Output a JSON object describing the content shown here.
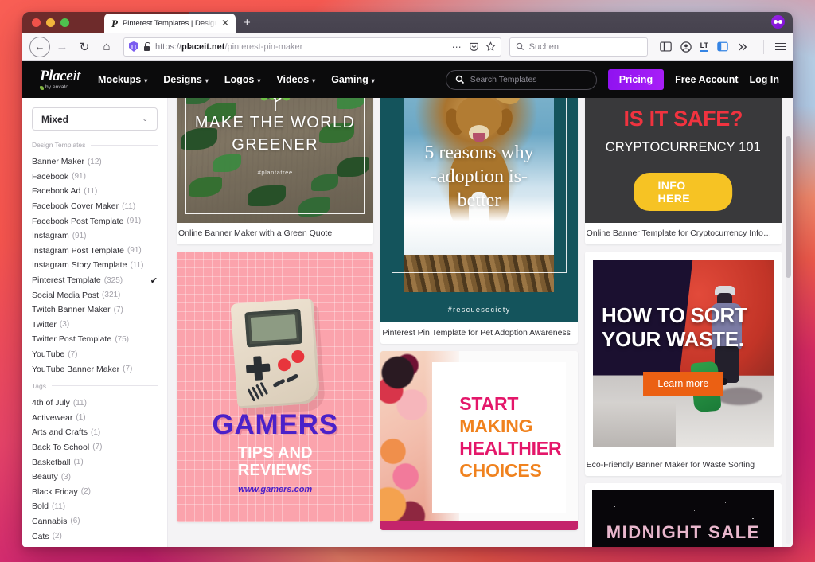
{
  "window": {
    "tab": {
      "favicon": "P",
      "title": "Pinterest Templates | Design Te",
      "close": "✕"
    },
    "new_tab": "+",
    "extension_icon_name": "mask-extension-icon"
  },
  "toolbar": {
    "back": "←",
    "forward": "→",
    "reload": "↻",
    "home": "⌂",
    "url_scheme": "https://",
    "url_domain": "placeit.net",
    "url_path": "/pinterest-pin-maker",
    "overflow": "⋯",
    "search_placeholder": "Suchen",
    "icons": [
      "reader-view-icon",
      "account-icon",
      "lt-translate-icon",
      "sidebar-icon",
      "chevron-double-right-icon",
      "menu-icon"
    ]
  },
  "site": {
    "brand": {
      "main": "Place",
      "main_italic": "it",
      "sub": "by envato"
    },
    "nav": [
      {
        "label": "Mockups"
      },
      {
        "label": "Designs"
      },
      {
        "label": "Logos"
      },
      {
        "label": "Videos"
      },
      {
        "label": "Gaming"
      }
    ],
    "search_placeholder": "Search Templates",
    "pricing": "Pricing",
    "free_account": "Free Account",
    "log_in": "Log In",
    "accent_purple": "#9b1ef5"
  },
  "sidebar": {
    "select_value": "Mixed",
    "select_chevron": "⌄",
    "groups": [
      {
        "title": "Design Templates",
        "items": [
          {
            "name": "Banner Maker",
            "count": "(12)",
            "selected": false
          },
          {
            "name": "Facebook",
            "count": "(91)",
            "selected": false
          },
          {
            "name": "Facebook Ad",
            "count": "(11)",
            "selected": false
          },
          {
            "name": "Facebook Cover Maker",
            "count": "(11)",
            "selected": false
          },
          {
            "name": "Facebook Post Template",
            "count": "(91)",
            "selected": false
          },
          {
            "name": "Instagram",
            "count": "(91)",
            "selected": false
          },
          {
            "name": "Instagram Post Template",
            "count": "(91)",
            "selected": false
          },
          {
            "name": "Instagram Story Template",
            "count": "(11)",
            "selected": false
          },
          {
            "name": "Pinterest Template",
            "count": "(325)",
            "selected": true
          },
          {
            "name": "Social Media Post",
            "count": "(321)",
            "selected": false
          },
          {
            "name": "Twitch Banner Maker",
            "count": "(7)",
            "selected": false
          },
          {
            "name": "Twitter",
            "count": "(3)",
            "selected": false
          },
          {
            "name": "Twitter Post Template",
            "count": "(75)",
            "selected": false
          },
          {
            "name": "YouTube",
            "count": "(7)",
            "selected": false
          },
          {
            "name": "YouTube Banner Maker",
            "count": "(7)",
            "selected": false
          }
        ]
      },
      {
        "title": "Tags",
        "items": [
          {
            "name": "4th of July",
            "count": "(11)",
            "selected": false
          },
          {
            "name": "Activewear",
            "count": "(1)",
            "selected": false
          },
          {
            "name": "Arts and Crafts",
            "count": "(1)",
            "selected": false
          },
          {
            "name": "Back To School",
            "count": "(7)",
            "selected": false
          },
          {
            "name": "Basketball",
            "count": "(1)",
            "selected": false
          },
          {
            "name": "Beauty",
            "count": "(3)",
            "selected": false
          },
          {
            "name": "Black Friday",
            "count": "(2)",
            "selected": false
          },
          {
            "name": "Bold",
            "count": "(11)",
            "selected": false
          },
          {
            "name": "Cannabis",
            "count": "(6)",
            "selected": false
          },
          {
            "name": "Cats",
            "count": "(2)",
            "selected": false
          }
        ]
      }
    ],
    "check_glyph": "✔"
  },
  "cards": {
    "green": {
      "headline_line1": "MAKE THE WORLD",
      "headline_line2": "GREENER",
      "hashtag": "#plantatree",
      "caption": "Online Banner Maker with a Green Quote"
    },
    "gamers": {
      "title": "GAMERS",
      "sub_line1": "TIPS AND",
      "sub_line2": "REVIEWS",
      "url": "www.gamers.com"
    },
    "dog": {
      "line1": "5 reasons why",
      "line2": "-adoption is-",
      "line3": "better",
      "hashtag": "#rescuesociety",
      "caption": "Pinterest Pin Template for Pet Adoption Awareness"
    },
    "health": {
      "l1": "START",
      "l2": "MAKING",
      "l3": "HEALTHIER",
      "l4": "CHOICES"
    },
    "crypto": {
      "headline": "IS IT SAFE?",
      "subhead": "CRYPTOCURRENCY 101",
      "button": "INFO HERE",
      "caption": "Online Banner Template for Cryptocurrency Info…"
    },
    "waste": {
      "line1": "HOW TO SORT",
      "line2": "YOUR WASTE.",
      "button": "Learn more",
      "caption": "Eco-Friendly Banner Maker for Waste Sorting"
    },
    "midnight": {
      "title": "MIDNIGHT SALE"
    }
  }
}
